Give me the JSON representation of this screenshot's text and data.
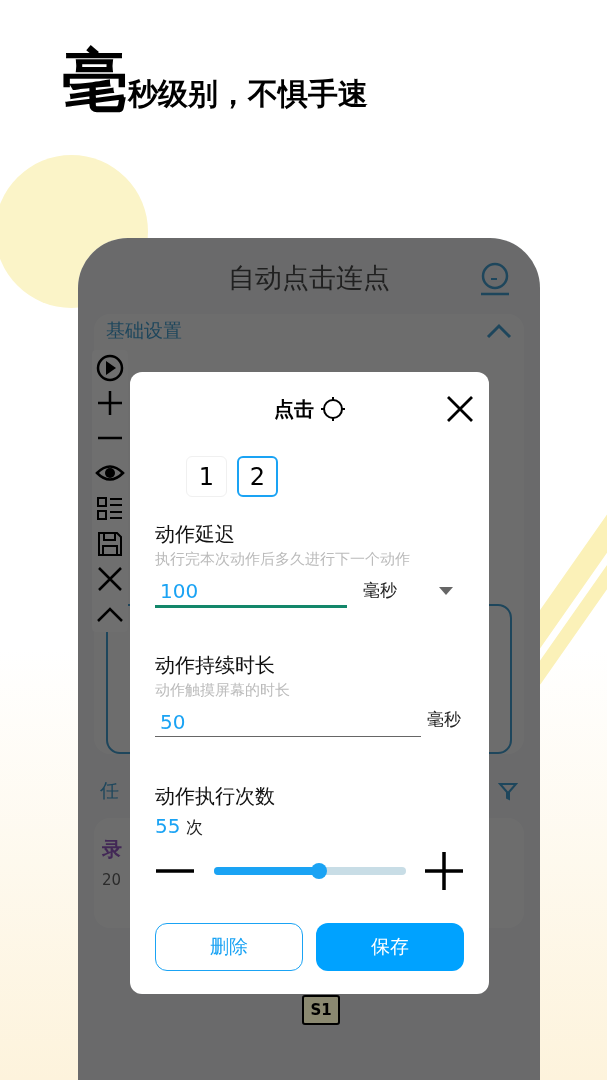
{
  "headline": {
    "big": "毫",
    "rest": "秒级别，不惧手速"
  },
  "app": {
    "title": "自动点击连点",
    "section": {
      "title": "基础设置",
      "expanded": true
    },
    "task_label": "任",
    "task_card": {
      "title": "录",
      "date": "20"
    }
  },
  "dialog": {
    "title": "点击",
    "steps": [
      {
        "label": "1",
        "selected": false
      },
      {
        "label": "2",
        "selected": true
      }
    ],
    "fields": [
      {
        "kind": "select",
        "label": "动作延迟",
        "hint": "执行完本次动作后多久进行下一个动作",
        "value": "100",
        "unit": "毫秒",
        "focused": true
      },
      {
        "kind": "text",
        "label": "动作持续时长",
        "hint": "动作触摸屏幕的时长",
        "value": "50",
        "unit": "毫秒",
        "focused": false
      }
    ],
    "count": {
      "label": "动作执行次数",
      "value": "55",
      "unit": "次",
      "level": 0.55
    },
    "buttons": [
      {
        "label": "删除",
        "kind": "outline"
      },
      {
        "label": "保存",
        "kind": "primary"
      }
    ]
  },
  "marker": {
    "label": "S1"
  }
}
